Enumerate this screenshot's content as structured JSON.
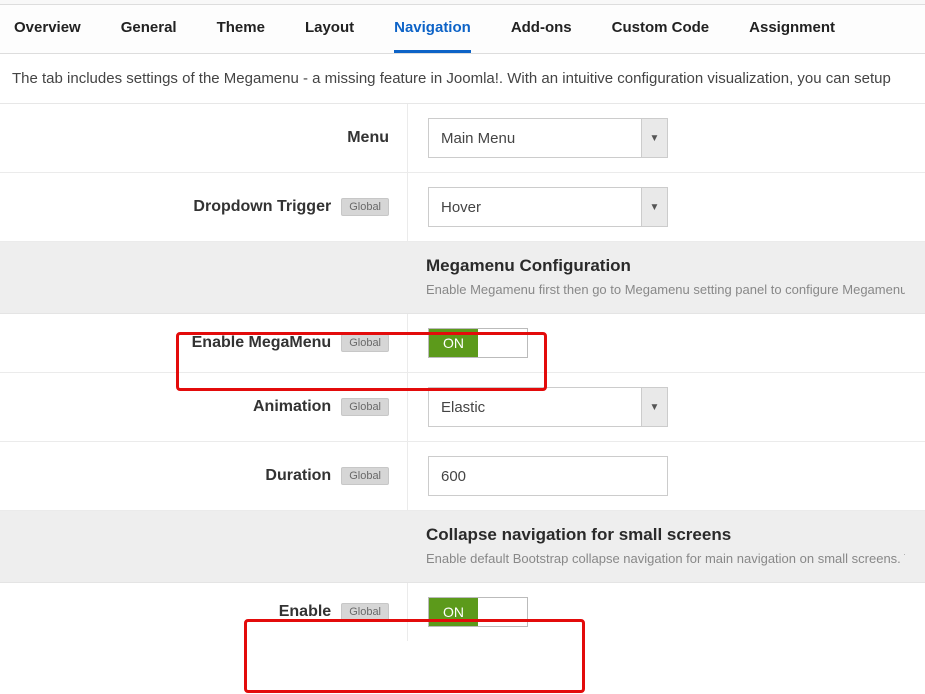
{
  "tabs": {
    "overview": "Overview",
    "general": "General",
    "theme": "Theme",
    "layout": "Layout",
    "navigation": "Navigation",
    "addons": "Add-ons",
    "customcode": "Custom Code",
    "assignment": "Assignment"
  },
  "intro": "The tab includes settings of the Megamenu - a missing feature in Joomla!. With an intuitive configuration visualization, you can setup",
  "labels": {
    "menu": "Menu",
    "dropdown": "Dropdown Trigger",
    "enableMega": "Enable MegaMenu",
    "animation": "Animation",
    "duration": "Duration",
    "enable": "Enable"
  },
  "badge": "Global",
  "values": {
    "menu": "Main Menu",
    "dropdown": "Hover",
    "animation": "Elastic",
    "duration": "600"
  },
  "toggle": {
    "on": "ON"
  },
  "section1": {
    "title": "Megamenu Configuration",
    "sub": "Enable Megamenu first then go to Megamenu setting panel to configure Megamenu"
  },
  "section2": {
    "title": "Collapse navigation for small screens",
    "sub": "Enable default Bootstrap collapse navigation for main navigation on small screens. This"
  }
}
